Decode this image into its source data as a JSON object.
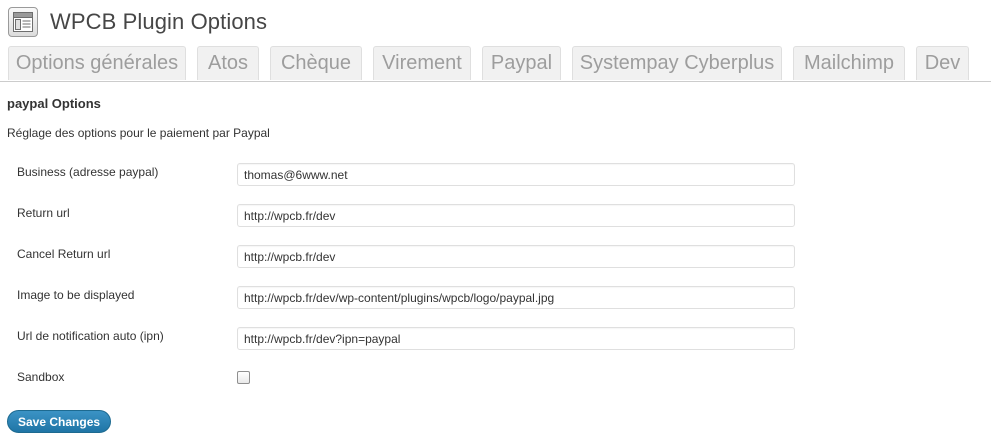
{
  "header": {
    "icon": "settings-page-icon",
    "title": "WPCB Plugin Options"
  },
  "tabs": [
    {
      "label": "Options générales"
    },
    {
      "label": "Atos"
    },
    {
      "label": "Chèque"
    },
    {
      "label": "Virement"
    },
    {
      "label": "Paypal"
    },
    {
      "label": "Systempay Cyberplus"
    },
    {
      "label": "Mailchimp"
    },
    {
      "label": "Dev"
    }
  ],
  "section": {
    "title": "paypal Options",
    "description": "Réglage des options pour le paiement par Paypal"
  },
  "fields": [
    {
      "label": "Business (adresse paypal)",
      "value": "thomas@6www.net"
    },
    {
      "label": "Return url",
      "value": "http://wpcb.fr/dev"
    },
    {
      "label": "Cancel Return url",
      "value": "http://wpcb.fr/dev"
    },
    {
      "label": "Image to be displayed",
      "value": "http://wpcb.fr/dev/wp-content/plugins/wpcb/logo/paypal.jpg"
    },
    {
      "label": "Url de notification auto (ipn)",
      "value": "http://wpcb.fr/dev?ipn=paypal"
    }
  ],
  "sandbox": {
    "label": "Sandbox",
    "checked": false
  },
  "save_button": {
    "label": "Save Changes",
    "color": "#2583b8"
  }
}
